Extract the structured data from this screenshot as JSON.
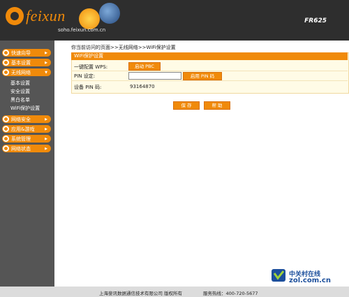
{
  "header": {
    "brand": "feixun",
    "slogan": "soho.feixun.com.cn",
    "model": "FR625"
  },
  "sidebar": {
    "menus": [
      {
        "label": "快速向导"
      },
      {
        "label": "基本设置"
      },
      {
        "label": "无线网络"
      },
      {
        "label": "网络安全"
      },
      {
        "label": "应用&游戏"
      },
      {
        "label": "系统管理"
      },
      {
        "label": "网络状态"
      }
    ],
    "wireless_subitems": [
      "基本设置",
      "安全设置",
      "黑白名单",
      "WiFi保护设置"
    ]
  },
  "breadcrumb": "你当前访问的页面>>无线网络>>WiFi保护设置",
  "panel": {
    "title": "WiFi保护设置",
    "rows": {
      "wps_label": "一键配置 WPS:",
      "wps_button": "启动 PBC",
      "pin_label": "PIN 设定:",
      "pin_input_value": "",
      "pin_button": "启用 PIN 码",
      "device_pin_label": "设备 PIN 码:",
      "device_pin_value": "93164870"
    }
  },
  "actions": {
    "save": "保 存",
    "help": "帮 助"
  },
  "footer": {
    "company": "上海斐讯数据通信技术有限公司",
    "rights": "版权所有",
    "hotline": "服务热线：400-720-5677"
  },
  "watermark": {
    "name": "中关村在线",
    "url": "zol.com.cn"
  }
}
